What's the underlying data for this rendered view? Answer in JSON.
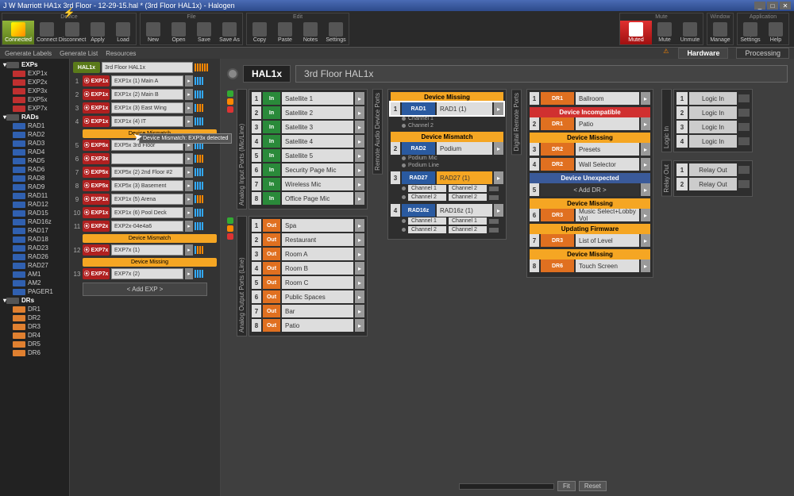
{
  "title": "J W Marriott HA1x 3rd Floor - 12-29-15.hal * (3rd Floor HAL1x) - Halogen",
  "toolbar": {
    "device": "Device",
    "file": "File",
    "edit": "Edit",
    "mute_grp": "Mute",
    "window": "Window",
    "app": "Application",
    "connected": "Connected",
    "connect": "Connect",
    "disconnect": "Disconnect",
    "apply": "Apply",
    "load": "Load",
    "new": "New",
    "open": "Open",
    "save": "Save",
    "saveas": "Save As",
    "copy": "Copy",
    "paste": "Paste",
    "notes": "Notes",
    "settings": "Settings",
    "muted": "Muted",
    "mute": "Mute",
    "unmute": "Unmute",
    "manage": "Manage",
    "help": "Help"
  },
  "subbar": {
    "gen_labels": "Generate Labels",
    "gen_list": "Generate List",
    "resources": "Resources",
    "hardware": "Hardware",
    "processing": "Processing"
  },
  "tree": {
    "exps": "EXPs",
    "exps_items": [
      "EXP1x",
      "EXP2x",
      "EXP3x",
      "EXP5x",
      "EXP7x"
    ],
    "rads": "RADs",
    "rads_items": [
      "RAD1",
      "RAD2",
      "RAD3",
      "RAD4",
      "RAD5",
      "RAD6",
      "RAD8",
      "RAD9",
      "RAD11",
      "RAD12",
      "RAD15",
      "RAD16z",
      "RAD17",
      "RAD18",
      "RAD23",
      "RAD26",
      "RAD27",
      "AM1",
      "AM2",
      "PAGER1"
    ],
    "drs": "DRs",
    "drs_items": [
      "DR1",
      "DR2",
      "DR3",
      "DR4",
      "DR5",
      "DR6"
    ]
  },
  "exp": {
    "hdr_badge": "HAL1x",
    "hdr_field": "3rd Floor HAL1x",
    "rows": [
      {
        "n": "1",
        "b": "EXP1x",
        "f": "EXP1x (1) Main A"
      },
      {
        "n": "2",
        "b": "EXP1x",
        "f": "EXP1x (2) Main B"
      },
      {
        "n": "3",
        "b": "EXP1x",
        "f": "EXP1x (3) East Wing"
      },
      {
        "n": "4",
        "b": "EXP1x",
        "f": "EXP1x (4) IT"
      },
      {
        "n": "5",
        "b": "EXP5x",
        "f": "EXP5x 3rd Floor",
        "warn": "Device Mismatch"
      },
      {
        "n": "6",
        "b": "EXP3x",
        "f": ""
      },
      {
        "n": "7",
        "b": "EXP5x",
        "f": "EXP5x (2) 2nd Floor #2"
      },
      {
        "n": "8",
        "b": "EXP5x",
        "f": "EXP5x (3) Basement"
      },
      {
        "n": "9",
        "b": "EXP1x",
        "f": "EXP1x (5) Arena"
      },
      {
        "n": "10",
        "b": "EXP1x",
        "f": "EXP1x (6) Pool Deck"
      },
      {
        "n": "11",
        "b": "EXP2x",
        "f": "EXP2x-04e4a6",
        "warn_after": "Device Mismatch"
      },
      {
        "n": "12",
        "b": "EXP7x",
        "f": "EXP7x (1)",
        "warn_after": "Device Missing"
      },
      {
        "n": "13",
        "b": "EXP7x",
        "f": "EXP7x (2)"
      }
    ],
    "tooltip": "Device Mismatch: EXP3x detected",
    "add": "< Add EXP >"
  },
  "device": {
    "name": "HAL1x",
    "sub": "3rd Floor HAL1x"
  },
  "ain": {
    "label": "Analog Input Ports (Mic/Line)",
    "rows": [
      {
        "n": "1",
        "io": "In",
        "f": "Satellite 1"
      },
      {
        "n": "2",
        "io": "In",
        "f": "Satellite 2"
      },
      {
        "n": "3",
        "io": "In",
        "f": "Satellite 3"
      },
      {
        "n": "4",
        "io": "In",
        "f": "Satellite 4"
      },
      {
        "n": "5",
        "io": "In",
        "f": "Satellite 5"
      },
      {
        "n": "6",
        "io": "In",
        "f": "Security Page Mic"
      },
      {
        "n": "7",
        "io": "In",
        "f": "Wireless Mic"
      },
      {
        "n": "8",
        "io": "In",
        "f": "Office Page Mic"
      }
    ]
  },
  "aout": {
    "label": "Analog Output Ports (Line)",
    "rows": [
      {
        "n": "1",
        "io": "Out",
        "f": "Spa"
      },
      {
        "n": "2",
        "io": "Out",
        "f": "Restaurant"
      },
      {
        "n": "3",
        "io": "Out",
        "f": "Room A"
      },
      {
        "n": "4",
        "io": "Out",
        "f": "Room B"
      },
      {
        "n": "5",
        "io": "Out",
        "f": "Room C"
      },
      {
        "n": "6",
        "io": "Out",
        "f": "Public Spaces"
      },
      {
        "n": "7",
        "io": "Out",
        "f": "Bar"
      },
      {
        "n": "8",
        "io": "Out",
        "f": "Patio"
      }
    ]
  },
  "rad": {
    "label": "Remote Audio Device Ports",
    "blocks": [
      {
        "n": "1",
        "warn": "Device Missing",
        "badge": "RAD1",
        "f": "RAD1 (1)",
        "sel": true,
        "ch": [
          {
            "t": "Channel 1"
          },
          {
            "t": "Channel 2"
          }
        ]
      },
      {
        "n": "2",
        "warn": "Device Mismatch",
        "badge": "RAD2",
        "f": "Podium",
        "ch": [
          {
            "t": "Podium Mic"
          },
          {
            "t": "Podium Line"
          }
        ]
      },
      {
        "n": "3",
        "badge": "RAD27",
        "f": "RAD27 (1)",
        "fwarn": true,
        "ch": [
          {
            "t": "Channel 1",
            "r": "Channel 2"
          },
          {
            "t": "Channel 2",
            "r": "Channel 2"
          }
        ]
      },
      {
        "n": "4",
        "badge": "RAD16z",
        "f": "RAD16z (1)",
        "ch": [
          {
            "t": "Channel 1",
            "r": "Channel 1"
          },
          {
            "t": "Channel 2",
            "r": "Channel 2"
          }
        ]
      }
    ]
  },
  "dr": {
    "label": "Digital Remote Ports",
    "blocks": [
      {
        "n": "1",
        "badge": "DR1",
        "f": "Ballroom"
      },
      {
        "n": "2",
        "warn": "Device Incompatible",
        "wc": "red",
        "badge": "DR1",
        "f": "Patio"
      },
      {
        "n": "3",
        "warn": "Device Missing",
        "badge": "DR2",
        "f": "Presets"
      },
      {
        "n": "4",
        "badge": "DR2",
        "f": "Wall Selector"
      },
      {
        "n": "5",
        "warn": "Device Unexpected",
        "wc": "blue",
        "add": "< Add DR >"
      },
      {
        "n": "6",
        "warn": "Device Missing",
        "badge": "DR3",
        "f": "Music Select+Lobby Vol"
      },
      {
        "n": "7",
        "warn": "Updating Firmware",
        "badge": "DR3",
        "f": "List of Level"
      },
      {
        "n": "8",
        "warn": "Device Missing",
        "badge": "DR6",
        "f": "Touch Screen"
      }
    ]
  },
  "logic": {
    "in_label": "Logic In",
    "out_label": "Relay Out",
    "in": [
      {
        "n": "1",
        "f": "Logic In"
      },
      {
        "n": "2",
        "f": "Logic In"
      },
      {
        "n": "3",
        "f": "Logic In"
      },
      {
        "n": "4",
        "f": "Logic In"
      }
    ],
    "out": [
      {
        "n": "1",
        "f": "Relay Out"
      },
      {
        "n": "2",
        "f": "Relay Out"
      }
    ]
  },
  "bottom": {
    "fit": "Fit",
    "reset": "Reset"
  }
}
